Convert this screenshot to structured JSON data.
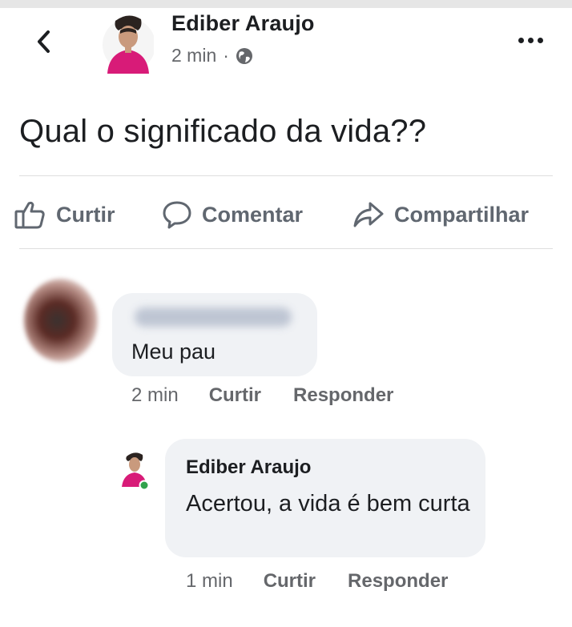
{
  "post": {
    "author": "Ediber Araujo",
    "time": "2 min",
    "separator": "·",
    "audience_icon": "globe-icon",
    "text": "Qual o significado da vida??"
  },
  "header": {
    "back_icon": "chevron-left-icon",
    "more_icon": "more-horizontal-icon"
  },
  "actions": {
    "like_label": "Curtir",
    "comment_label": "Comentar",
    "share_label": "Compartilhar"
  },
  "comments": [
    {
      "author_blurred": true,
      "text": "Meu pau",
      "time": "2 min",
      "like_label": "Curtir",
      "reply_label": "Responder",
      "replies": [
        {
          "author": "Ediber Araujo",
          "online": true,
          "text": "Acertou, a vida é bem curta",
          "time": "1 min",
          "like_label": "Curtir",
          "reply_label": "Responder"
        }
      ]
    }
  ],
  "colors": {
    "text_primary": "#1c1e21",
    "text_secondary": "#65676b",
    "action_grey": "#606770",
    "bubble_bg": "#f0f2f5",
    "online_dot": "#31a24c"
  }
}
